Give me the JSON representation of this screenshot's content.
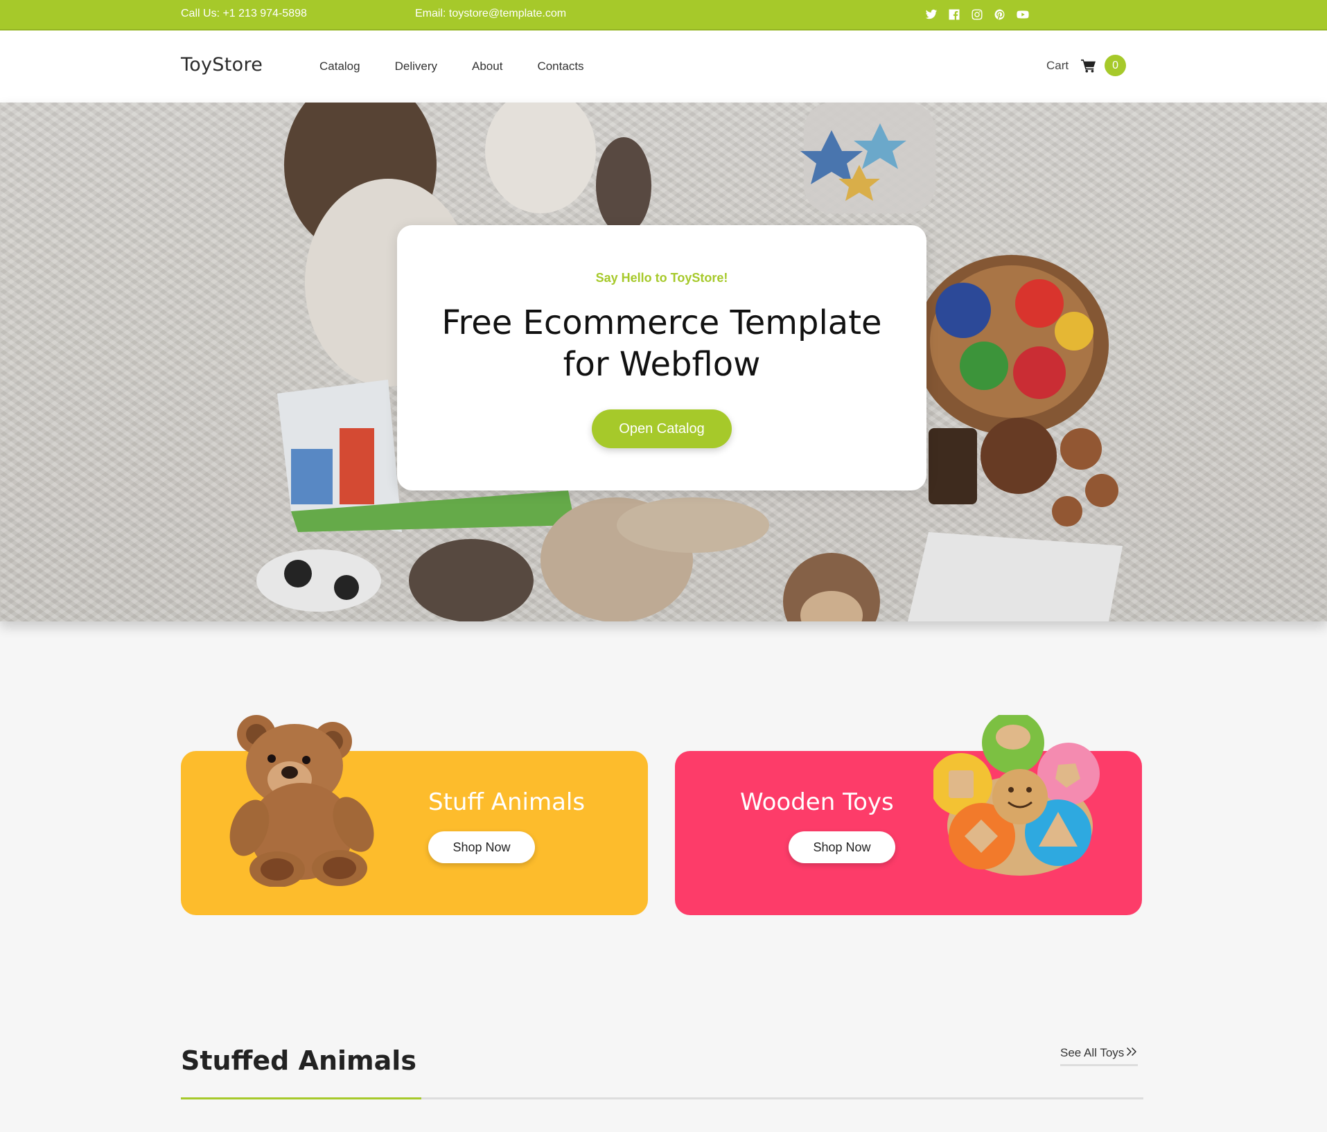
{
  "topbar": {
    "phone": "Call Us: +1 213 974-5898",
    "email": "Email: toystore@template.com",
    "social_icons": [
      "twitter-icon",
      "facebook-icon",
      "instagram-icon",
      "pinterest-icon",
      "youtube-icon"
    ]
  },
  "header": {
    "logo": "ToyStore",
    "nav": [
      "Catalog",
      "Delivery",
      "About",
      "Contacts"
    ],
    "cart_label": "Cart",
    "cart_count": "0"
  },
  "hero": {
    "eyebrow": "Say Hello to ToyStore!",
    "headline": "Free Ecommerce Template for Webflow",
    "cta": "Open Catalog"
  },
  "categories": [
    {
      "title": "Stuff Animals",
      "button": "Shop Now",
      "color": "#fdbc2c"
    },
    {
      "title": "Wooden Toys",
      "button": "Shop Now",
      "color": "#fd3c69"
    }
  ],
  "section": {
    "title": "Stuffed Animals",
    "see_all": "See All Toys"
  },
  "colors": {
    "accent": "#a6c92a",
    "background": "#f6f6f6"
  }
}
